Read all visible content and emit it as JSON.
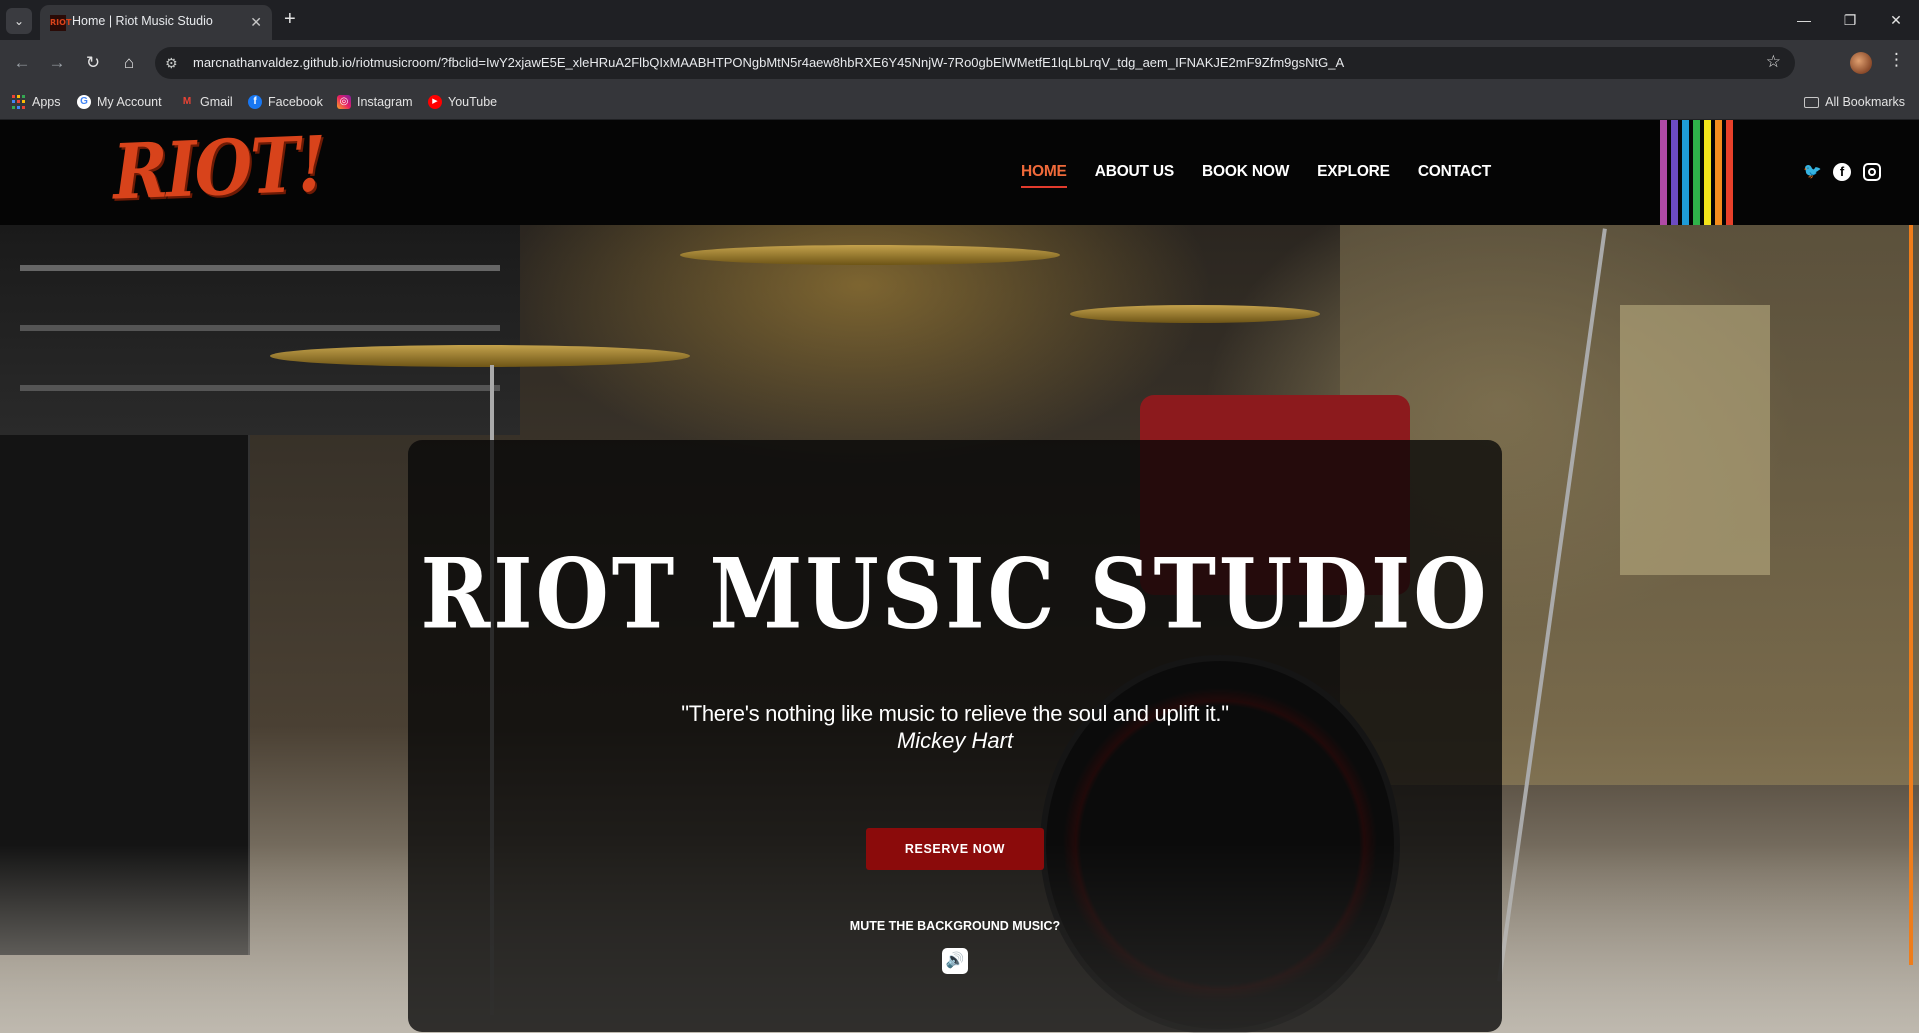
{
  "browser": {
    "tab": {
      "title": "Home | Riot Music Studio",
      "favicon": "riot-favicon"
    },
    "url": "marcnathanvaldez.github.io/riotmusicroom/?fbclid=IwY2xjawE5E_xleHRuA2FlbQIxMAABHTPONgbMtN5r4aew8hbRXE6Y45NnjW-7Ro0gbElWMetfE1lqLbLrqV_tdg_aem_IFNAKJE2mF9Zfm9gsNtG_A",
    "bookmarks": [
      {
        "label": "Apps",
        "icon": "apps-grid-icon"
      },
      {
        "label": "My Account",
        "icon": "google-icon"
      },
      {
        "label": "Gmail",
        "icon": "gmail-icon"
      },
      {
        "label": "Facebook",
        "icon": "facebook-icon"
      },
      {
        "label": "Instagram",
        "icon": "instagram-icon"
      },
      {
        "label": "YouTube",
        "icon": "youtube-icon"
      }
    ],
    "all_bookmarks": "All Bookmarks"
  },
  "site": {
    "logo": "RIOT!",
    "nav": [
      {
        "label": "HOME",
        "active": true
      },
      {
        "label": "ABOUT US",
        "active": false
      },
      {
        "label": "BOOK NOW",
        "active": false
      },
      {
        "label": "EXPLORE",
        "active": false
      },
      {
        "label": "CONTACT",
        "active": false
      }
    ],
    "stripe_colors": [
      "#b04aa6",
      "#6c4bc2",
      "#1e9bd7",
      "#2fb34a",
      "#f2e21a",
      "#f28c1e",
      "#e8402a"
    ],
    "social": [
      "twitter-icon",
      "facebook-icon",
      "instagram-icon"
    ],
    "accent": "#e23b2d"
  },
  "hero": {
    "title": "RIOT MUSIC STUDIO",
    "quote": "\"There's nothing like music to relieve the soul and uplift it.\"",
    "author": "Mickey Hart",
    "cta": "RESERVE NOW",
    "mute_label": "MUTE THE BACKGROUND MUSIC?",
    "mute_icon": "speaker-icon"
  }
}
